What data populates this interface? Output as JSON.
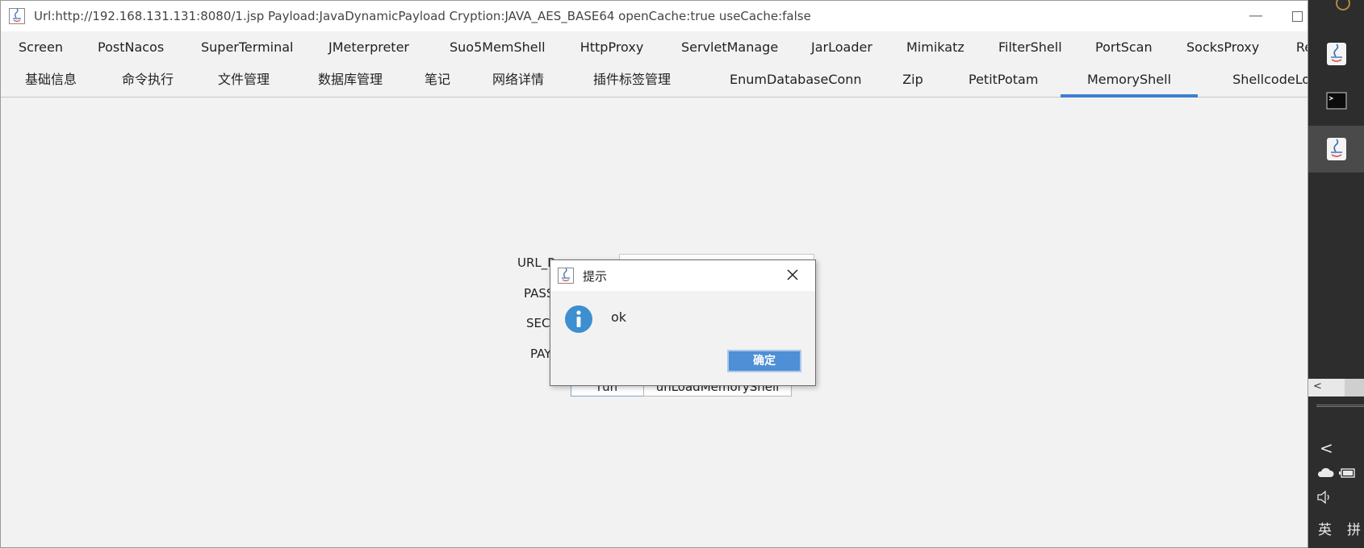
{
  "window": {
    "title": "Url:http://192.168.131.131:8080/1.jsp Payload:JavaDynamicPayload Cryption:JAVA_AES_BASE64 openCache:true useCache:false",
    "minimize_glyph": "—"
  },
  "tabs_row1": [
    "Screen",
    "PostNacos",
    "SuperTerminal",
    "JMeterpreter",
    "Suo5MemShell",
    "HttpProxy",
    "ServletManage",
    "JarLoader",
    "Mimikatz",
    "FilterShell",
    "PortScan",
    "SocksProxy",
    "Re"
  ],
  "tabs_row2": [
    "基础信息",
    "命令执行",
    "文件管理",
    "数据库管理",
    "笔记",
    "网络详情",
    "插件标签管理",
    "EnumDatabaseConn",
    "Zip",
    "PetitPotam",
    "MemoryShell",
    "ShellcodeLoa"
  ],
  "active_tab": "MemoryShell",
  "form": {
    "url_label": "URL_P",
    "pass_label": "PASS",
    "secret_label": "SEC",
    "payload_label": "PAY",
    "run_label": "run",
    "unload_label": "unLoadMemoryShell"
  },
  "dialog": {
    "title": "提示",
    "message": "ok",
    "ok_label": "确定"
  },
  "taskbar": {
    "input_lang": "英",
    "input_mode": "拼",
    "chevron": "<",
    "scroll_arrow": "<"
  },
  "colors": {
    "accent": "#3c7fd0",
    "ok_button": "#4e8fd5",
    "info_icon": "#3c8fd0",
    "taskbar": "#2d2d2d"
  }
}
